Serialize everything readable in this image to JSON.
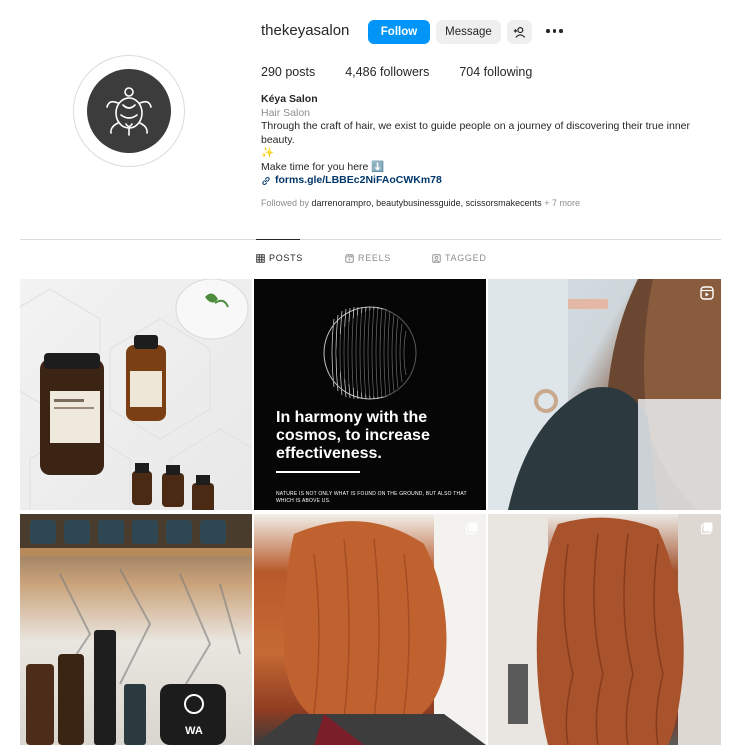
{
  "profile": {
    "username": "thekeyasalon",
    "follow_label": "Follow",
    "message_label": "Message",
    "add_user_icon": "add-user-icon",
    "more_icon": "more-options-icon"
  },
  "stats": {
    "posts": "290",
    "posts_label": "posts",
    "followers": "4,486",
    "followers_label": "followers",
    "following": "704",
    "following_label": "following"
  },
  "bio": {
    "name": "Kéya Salon",
    "category": "Hair Salon",
    "text": "Through the craft of hair, we exist to guide people on a journey of discovering their true inner beauty.",
    "sparkle": "✨",
    "cta": "Make time for you here ⬇️",
    "link": "forms.gle/LBBEc2NiFAoCWKm78"
  },
  "followed_by": {
    "prefix": "Followed by",
    "names": "darrenorampro, beautybusinessguide, scissorsmakecents",
    "more": "+ 7 more"
  },
  "tabs": [
    {
      "label": "POSTS",
      "icon": "grid-icon",
      "active": true
    },
    {
      "label": "REELS",
      "icon": "reels-icon",
      "active": false
    },
    {
      "label": "TAGGED",
      "icon": "tagged-icon",
      "active": false
    }
  ],
  "posts": {
    "moon_headline": "In harmony with the cosmos, to increase effectiveness.",
    "moon_footnote": "NATURE IS NOT ONLY WHAT IS FOUND ON THE GROUND, BUT ALSO THAT WHICH IS ABOVE US.",
    "bottle_brand": "WA"
  },
  "colors": {
    "accent": "#0095f6",
    "link": "#00376b",
    "muted": "#8e8e8e"
  }
}
